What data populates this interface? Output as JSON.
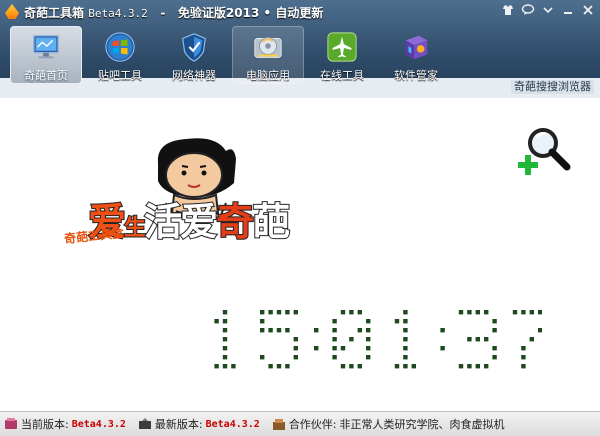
{
  "window": {
    "app_name": "奇葩工具箱",
    "version": "Beta4.3.2",
    "title_sep": "-",
    "tagline": "免验证版2013 • 自动更新"
  },
  "toolbar": {
    "items": [
      {
        "label": "奇葩首页",
        "icon": "monitor-icon",
        "active": true
      },
      {
        "label": "贴吧工具",
        "icon": "windows-orb-icon",
        "active": false
      },
      {
        "label": "网络神器",
        "icon": "shield-icon",
        "active": false
      },
      {
        "label": "电脑应用",
        "icon": "disc-icon",
        "active": false
      },
      {
        "label": "在线工具",
        "icon": "airplane-icon",
        "active": false
      },
      {
        "label": "软件管家",
        "icon": "software-box-icon",
        "active": false
      }
    ],
    "browser_label": "奇葩搜搜浏览器"
  },
  "content": {
    "slogan_parts": [
      "爱",
      "生",
      "活",
      "爱",
      "奇",
      "葩"
    ],
    "logo_sub": "奇葩工具盒",
    "clock_time": "15:01:37",
    "clock_color": "#1f4a1f"
  },
  "statusbar": {
    "current_label": "当前版本:",
    "current_value": "Beta4.3.2",
    "latest_label": "最新版本:",
    "latest_value": "Beta4.3.2",
    "partner_label": "合作伙伴:",
    "partner_value": "非正常人类研究学院、肉食虚拟机"
  }
}
